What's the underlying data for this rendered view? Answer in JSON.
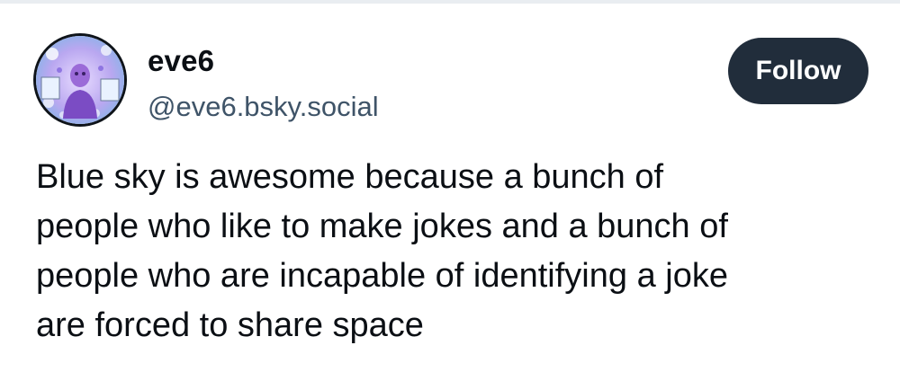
{
  "author": {
    "display_name": "eve6",
    "handle": "@eve6.bsky.social",
    "avatar_icon": "profile-avatar-image"
  },
  "actions": {
    "follow_label": "Follow"
  },
  "post": {
    "lines": [
      "Blue sky is awesome because a bunch of",
      "people who like to make jokes and a bunch of",
      "people who are incapable of identifying a joke",
      "are forced to share space"
    ]
  },
  "colors": {
    "follow_button_bg": "#212d3b",
    "handle_text": "#3f5468",
    "body_text": "#0b0f14"
  }
}
